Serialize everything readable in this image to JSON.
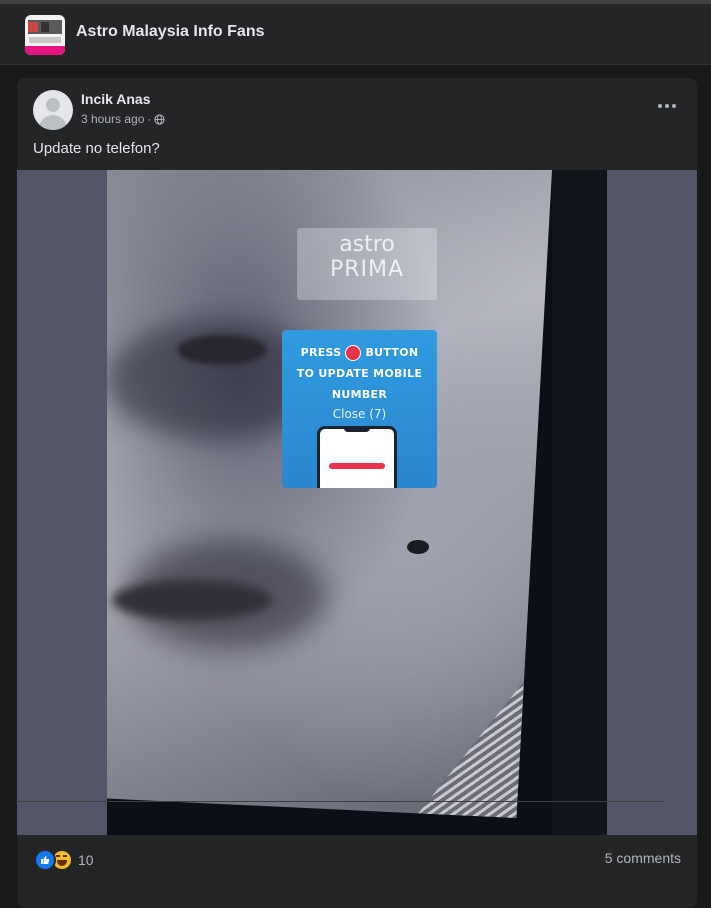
{
  "group": {
    "name": "Astro Malaysia Info Fans"
  },
  "post": {
    "author": "Incik Anas",
    "time": "3 hours ago",
    "separator": "·",
    "text": "Update no telefon?",
    "image": {
      "channel_logo_line1": "astro",
      "channel_logo_line2": "PRIMA",
      "popup_press": "PRESS",
      "popup_button": "BUTTON",
      "popup_line2": "TO UPDATE MOBILE",
      "popup_line3": "NUMBER",
      "popup_close": "Close (7)"
    },
    "reaction_count": "10",
    "comments": "5 comments"
  },
  "colors": {
    "background": "#18191a",
    "card": "#242526",
    "text_primary": "#e4e6eb",
    "text_secondary": "#b0b3b8",
    "like_blue": "#1877f2",
    "haha_yellow": "#f7b928",
    "popup_blue": "#2b86cf"
  },
  "icons": [
    "group-thumbnail-icon",
    "avatar-icon",
    "globe-icon",
    "more-options-icon",
    "like-icon",
    "haha-icon",
    "red-dot-icon"
  ]
}
